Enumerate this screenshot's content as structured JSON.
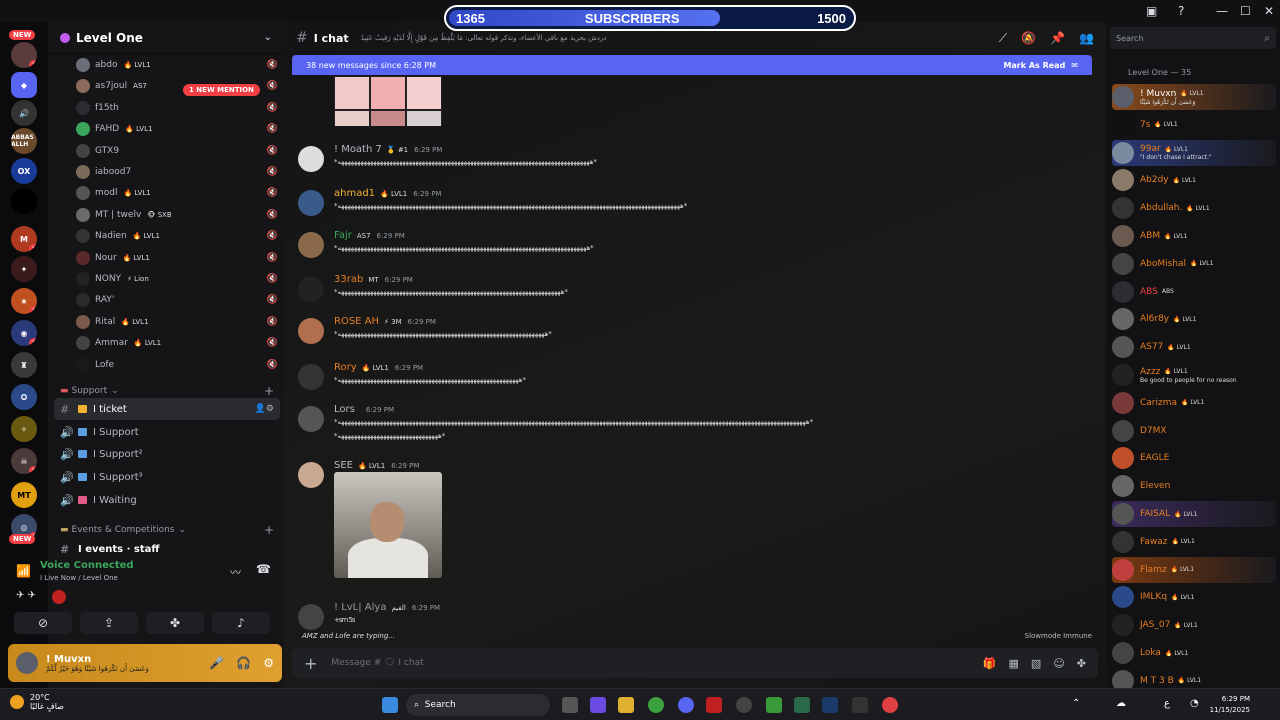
{
  "overlay": {
    "current": "1365",
    "label": "SUBSCRIBERS",
    "goal": "1500",
    "progress": 0.67
  },
  "rail": {
    "new_label": "NEW",
    "badges": [
      "3",
      "2",
      "1",
      "1",
      "2",
      "1"
    ],
    "servers": [
      "ABBAS ALLH",
      "OX",
      "M",
      "MT"
    ]
  },
  "guild": {
    "name": "Level One"
  },
  "voice_users": [
    {
      "name": "abdo",
      "tag": "🔥 LVL1"
    },
    {
      "name": "as7joul",
      "tag": "AS7"
    },
    {
      "name": "f15th",
      "tag": ""
    },
    {
      "name": "FAHD",
      "tag": "🔥 LVL1"
    },
    {
      "name": "GTX9",
      "tag": ""
    },
    {
      "name": "iabood7",
      "tag": ""
    },
    {
      "name": "modl",
      "tag": "🔥 LVL1"
    },
    {
      "name": "MT | twelv",
      "tag": "🐵 SXB"
    },
    {
      "name": "Nadien",
      "tag": "🔥 LVL1"
    },
    {
      "name": "Nour",
      "tag": "🔥 LVL1"
    },
    {
      "name": "NONY",
      "tag": "⚡ Lion"
    },
    {
      "name": "RAY'",
      "tag": ""
    },
    {
      "name": "Rital",
      "tag": "🔥 LVL1"
    },
    {
      "name": "Ammar",
      "tag": "🔥 LVL1"
    },
    {
      "name": "Lofe",
      "tag": ""
    }
  ],
  "mention": "1 NEW MENTION",
  "categories": {
    "support": "Support",
    "events": "Events & Competitions"
  },
  "channels": [
    {
      "name": "I ticket",
      "icon": "#"
    },
    {
      "name": "I Support",
      "icon": "🔊"
    },
    {
      "name": "I Support²",
      "icon": "🔊"
    },
    {
      "name": "I Support³",
      "icon": "🔊"
    },
    {
      "name": "I Waiting",
      "icon": "🔊"
    },
    {
      "name": "I events · staff",
      "icon": "#"
    }
  ],
  "voice": {
    "status": "Voice Connected",
    "sub": "I Live Now / Level One"
  },
  "user": {
    "name": "! Muvxn",
    "status": "وَعَسَىٰ أَن تَكْرَهُوا شَيْئًا وَهُوَ خَيْرٌ لَّكُمْ"
  },
  "chat": {
    "channel": "I chat",
    "topic": "دردش بحرية مع باقي الأعضاء، وتذكر قوله تعالى: مَا يَلْفِظُ مِن قَوْلٍ إِلَّا لَدَيْهِ رَقِيبٌ عَتِيدٌ",
    "new_messages": "38 new messages since 6:28 PM",
    "mark_read": "Mark As Read",
    "composer_placeholder": "Message # 🗨 I chat",
    "typing": "AMZ and Lofe are typing...",
    "slowmode": "Slowmode Immune"
  },
  "messages": [
    {
      "author": "! Moath 7",
      "tag": "🥇 #1",
      "time": "6:29 PM",
      "color": "#b5bac1",
      "body": "*ههههههههههههههههههههههههههههههههههههههههههههههههههههههههههههههههههههههههههههههه*"
    },
    {
      "author": "ahmad1",
      "tag": "🔥 LVL1",
      "time": "6:29 PM",
      "color": "#f0b232",
      "body": "*ههههههههههههههههههههههههههههههههههههههههههههههههههههههههههههههههههههههههههههههههههههههههههههههههههههههههههه*"
    },
    {
      "author": "Fajr",
      "tag": "AS7",
      "time": "6:29 PM",
      "color": "#3ba55d",
      "body": "*هههههههههههههههههههههههههههههههههههههههههههههههههههههههههههههههههههههههههههههه*"
    },
    {
      "author": "33rab",
      "tag": "MT",
      "time": "6:29 PM",
      "color": "#e67e22",
      "body": "*هههههههههههههههههههههههههههههههههههههههههههههههههههههههههههههههههههههه*"
    },
    {
      "author": "ROSE AH",
      "tag": "⚡ 3M",
      "time": "6:29 PM",
      "color": "#e67e22",
      "body": "*ههههههههههههههههههههههههههههههههههههههههههههههههههههههههههههههههه*"
    },
    {
      "author": "Rory",
      "tag": "🔥 LVL1",
      "time": "6:29 PM",
      "color": "#e67e22",
      "body": "*ههههههههههههههههههههههههههههههههههههههههههههههههههههههههه*"
    },
    {
      "author": "Lors",
      "tag": "",
      "time": "6:29 PM",
      "color": "#b5bac1",
      "body": "*هههههههههههههههههههههههههههههههههههههههههههههههههههههههههههههههههههههههههههههههههههههههههههههههههههههههههههههههههههههههههههههههههههههههههههههههههه*",
      "body2": "*هههههههههههههههههههههههههههههههه*"
    },
    {
      "author": "SEE",
      "tag": "🔥 LVL1",
      "time": "6:29 PM",
      "color": "#b5bac1",
      "body": ""
    },
    {
      "author": "! LvL| Alya",
      "tag": "القيم",
      "time": "6:29 PM",
      "color": "#949ba4",
      "body": "+sm 5s"
    }
  ],
  "members": {
    "title": "Level One — 35",
    "search_placeholder": "Search",
    "list": [
      {
        "name": "! Muvxn",
        "tag": "🔥 LVL1",
        "sub": "وَعَسَىٰ أَن تَكْرَهُوا شَيْئًا",
        "color": "#ffffff",
        "bg": "#8a4a1a",
        "av": "#5a5f6b"
      },
      {
        "name": "7s",
        "tag": "🔥 LVL1",
        "sub": "",
        "color": "#e67e22",
        "bg": "",
        "av": "#111"
      },
      {
        "name": "99ar",
        "tag": "🔥 LVL1",
        "sub": "\"I don't chase I attract.\"",
        "color": "#e67e22",
        "bg": "#2a3a7a",
        "av": "#7c8aa0"
      },
      {
        "name": "Ab2dy",
        "tag": "🔥 LVL1",
        "sub": "",
        "color": "#e67e22",
        "bg": "",
        "av": "#8a7a6a"
      },
      {
        "name": "Abdullah.",
        "tag": "🔥 LVL1",
        "sub": "",
        "color": "#e67e22",
        "bg": "",
        "av": "#333"
      },
      {
        "name": "ABM",
        "tag": "🔥 LVL1",
        "sub": "",
        "color": "#e67e22",
        "bg": "",
        "av": "#6a5a50"
      },
      {
        "name": "AboMishal",
        "tag": "🔥 LVL1",
        "sub": "",
        "color": "#e67e22",
        "bg": "",
        "av": "#444"
      },
      {
        "name": "ABS",
        "tag": "ABS",
        "sub": "",
        "color": "#f23f43",
        "bg": "",
        "av": "#2b2d31"
      },
      {
        "name": "Al6r8y",
        "tag": "🔥 LVL1",
        "sub": "",
        "color": "#e67e22",
        "bg": "",
        "av": "#666"
      },
      {
        "name": "AS77",
        "tag": "🔥 LVL1",
        "sub": "",
        "color": "#e67e22",
        "bg": "",
        "av": "#555"
      },
      {
        "name": "Azzz",
        "tag": "🔥 LVL1",
        "sub": "Be good to people for no reason",
        "color": "#e67e22",
        "bg": "",
        "av": "#222"
      },
      {
        "name": "Carizma",
        "tag": "🔥 LVL1",
        "sub": "",
        "color": "#e67e22",
        "bg": "",
        "av": "#7a3a3a"
      },
      {
        "name": "D7MX",
        "tag": "",
        "sub": "",
        "color": "#e67e22",
        "bg": "",
        "av": "#444"
      },
      {
        "name": "EAGLE",
        "tag": "",
        "sub": "",
        "color": "#e67e22",
        "bg": "",
        "av": "#c0502a"
      },
      {
        "name": "Eleven",
        "tag": "",
        "sub": "",
        "color": "#e67e22",
        "bg": "",
        "av": "#666"
      },
      {
        "name": "FAISAL",
        "tag": "🔥 LVL1",
        "sub": "",
        "color": "#e67e22",
        "bg": "#3a2a5a",
        "av": "#555"
      },
      {
        "name": "Fawaz",
        "tag": "🔥 LVL1",
        "sub": "",
        "color": "#e67e22",
        "bg": "",
        "av": "#333"
      },
      {
        "name": "Flamz",
        "tag": "🔥 LVL1",
        "sub": "",
        "color": "#e67e22",
        "bg": "#7a3a10",
        "av": "#c04040"
      },
      {
        "name": "IMLKq",
        "tag": "🔥 LVL1",
        "sub": "",
        "color": "#e67e22",
        "bg": "",
        "av": "#2a4a8a"
      },
      {
        "name": "JAS_07",
        "tag": "🔥 LVL1",
        "sub": "",
        "color": "#e67e22",
        "bg": "",
        "av": "#222"
      },
      {
        "name": "Loka",
        "tag": "🔥 LVL1",
        "sub": "",
        "color": "#e67e22",
        "bg": "",
        "av": "#444"
      },
      {
        "name": "M T 3 B",
        "tag": "🔥 LVL1",
        "sub": "",
        "color": "#e67e22",
        "bg": "",
        "av": "#555"
      }
    ]
  },
  "taskbar": {
    "temp": "20°C",
    "weather": "صافٍ غالبًا",
    "search": "Search",
    "time": "6:29 PM",
    "date": "11/15/2025",
    "lang": "ع"
  }
}
